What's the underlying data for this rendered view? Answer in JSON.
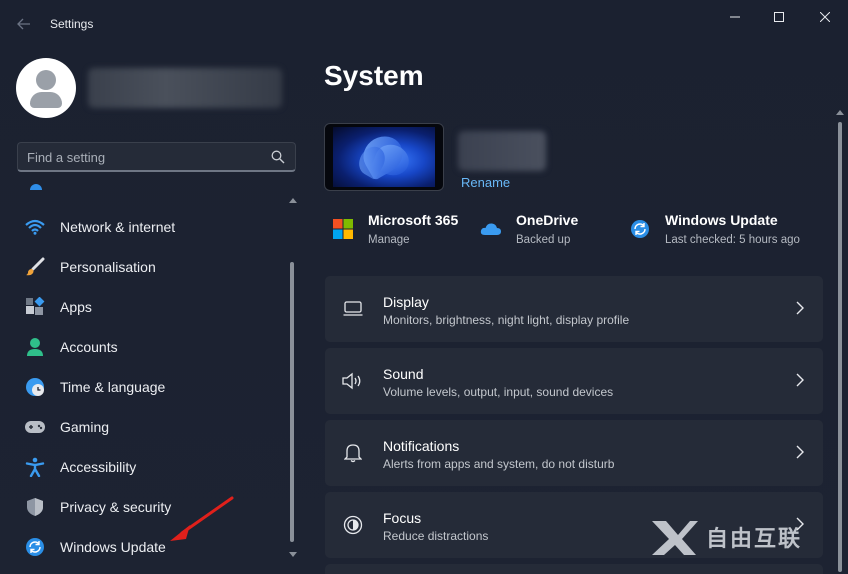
{
  "window": {
    "app_title": "Settings",
    "colors": {
      "accent": "#2f8ee8",
      "background": "#1c2230",
      "card": "#252b38",
      "link": "#69b8f7"
    }
  },
  "sidebar": {
    "search": {
      "placeholder": "Find a setting",
      "value": ""
    },
    "items": [
      {
        "label": "Network & internet",
        "icon": "wifi-icon"
      },
      {
        "label": "Personalisation",
        "icon": "paintbrush-icon"
      },
      {
        "label": "Apps",
        "icon": "apps-icon"
      },
      {
        "label": "Accounts",
        "icon": "person-icon"
      },
      {
        "label": "Time & language",
        "icon": "clock-globe-icon"
      },
      {
        "label": "Gaming",
        "icon": "gamepad-icon"
      },
      {
        "label": "Accessibility",
        "icon": "accessibility-icon"
      },
      {
        "label": "Privacy & security",
        "icon": "shield-icon"
      },
      {
        "label": "Windows Update",
        "icon": "update-icon"
      }
    ]
  },
  "main": {
    "title": "System",
    "rename_label": "Rename",
    "quick": [
      {
        "title": "Microsoft 365",
        "subtitle": "Manage",
        "icon": "microsoft-logo-icon"
      },
      {
        "title": "OneDrive",
        "subtitle": "Backed up",
        "icon": "onedrive-cloud-icon"
      },
      {
        "title": "Windows Update",
        "subtitle": "Last checked: 5 hours ago",
        "icon": "update-icon"
      }
    ],
    "cards": [
      {
        "title": "Display",
        "subtitle": "Monitors, brightness, night light, display profile",
        "icon": "monitor-icon"
      },
      {
        "title": "Sound",
        "subtitle": "Volume levels, output, input, sound devices",
        "icon": "speaker-icon"
      },
      {
        "title": "Notifications",
        "subtitle": "Alerts from apps and system, do not disturb",
        "icon": "bell-icon"
      },
      {
        "title": "Focus",
        "subtitle": "Reduce distractions",
        "icon": "focus-icon"
      }
    ]
  },
  "watermark": {
    "text": "自由互联"
  }
}
